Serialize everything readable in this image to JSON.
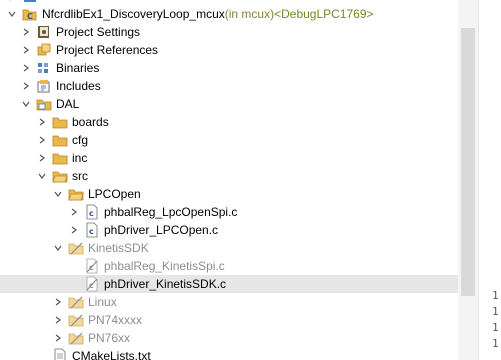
{
  "tree": {
    "root": {
      "name": "NfcrdlibEx1_DiscoveryLoop_mcux",
      "scope": " (in mcux)",
      "config": " <DebugLPC1769>"
    },
    "items": [
      {
        "label": "Project Settings"
      },
      {
        "label": "Project References"
      },
      {
        "label": "Binaries"
      },
      {
        "label": "Includes"
      },
      {
        "label": "DAL"
      },
      {
        "label": "boards"
      },
      {
        "label": "cfg"
      },
      {
        "label": "inc"
      },
      {
        "label": "src"
      },
      {
        "label": "LPCOpen"
      },
      {
        "label": "phbalReg_LpcOpenSpi.c"
      },
      {
        "label": "phDriver_LPCOpen.c"
      },
      {
        "label": "KinetisSDK"
      },
      {
        "label": "phbalReg_KinetisSpi.c"
      },
      {
        "label": "phDriver_KinetisSDK.c"
      },
      {
        "label": "Linux"
      },
      {
        "label": "PN74xxxx"
      },
      {
        "label": "PN76xx"
      },
      {
        "label": "CMakeLists.txt"
      }
    ]
  },
  "gutter": {
    "lines": [
      "1",
      "1",
      "1",
      "1"
    ]
  },
  "colors": {
    "folder": "#e8b84a",
    "selected_row": "#e6e6e6",
    "muted_text": "#8c8c8c",
    "config_text": "#8a7e3a"
  }
}
